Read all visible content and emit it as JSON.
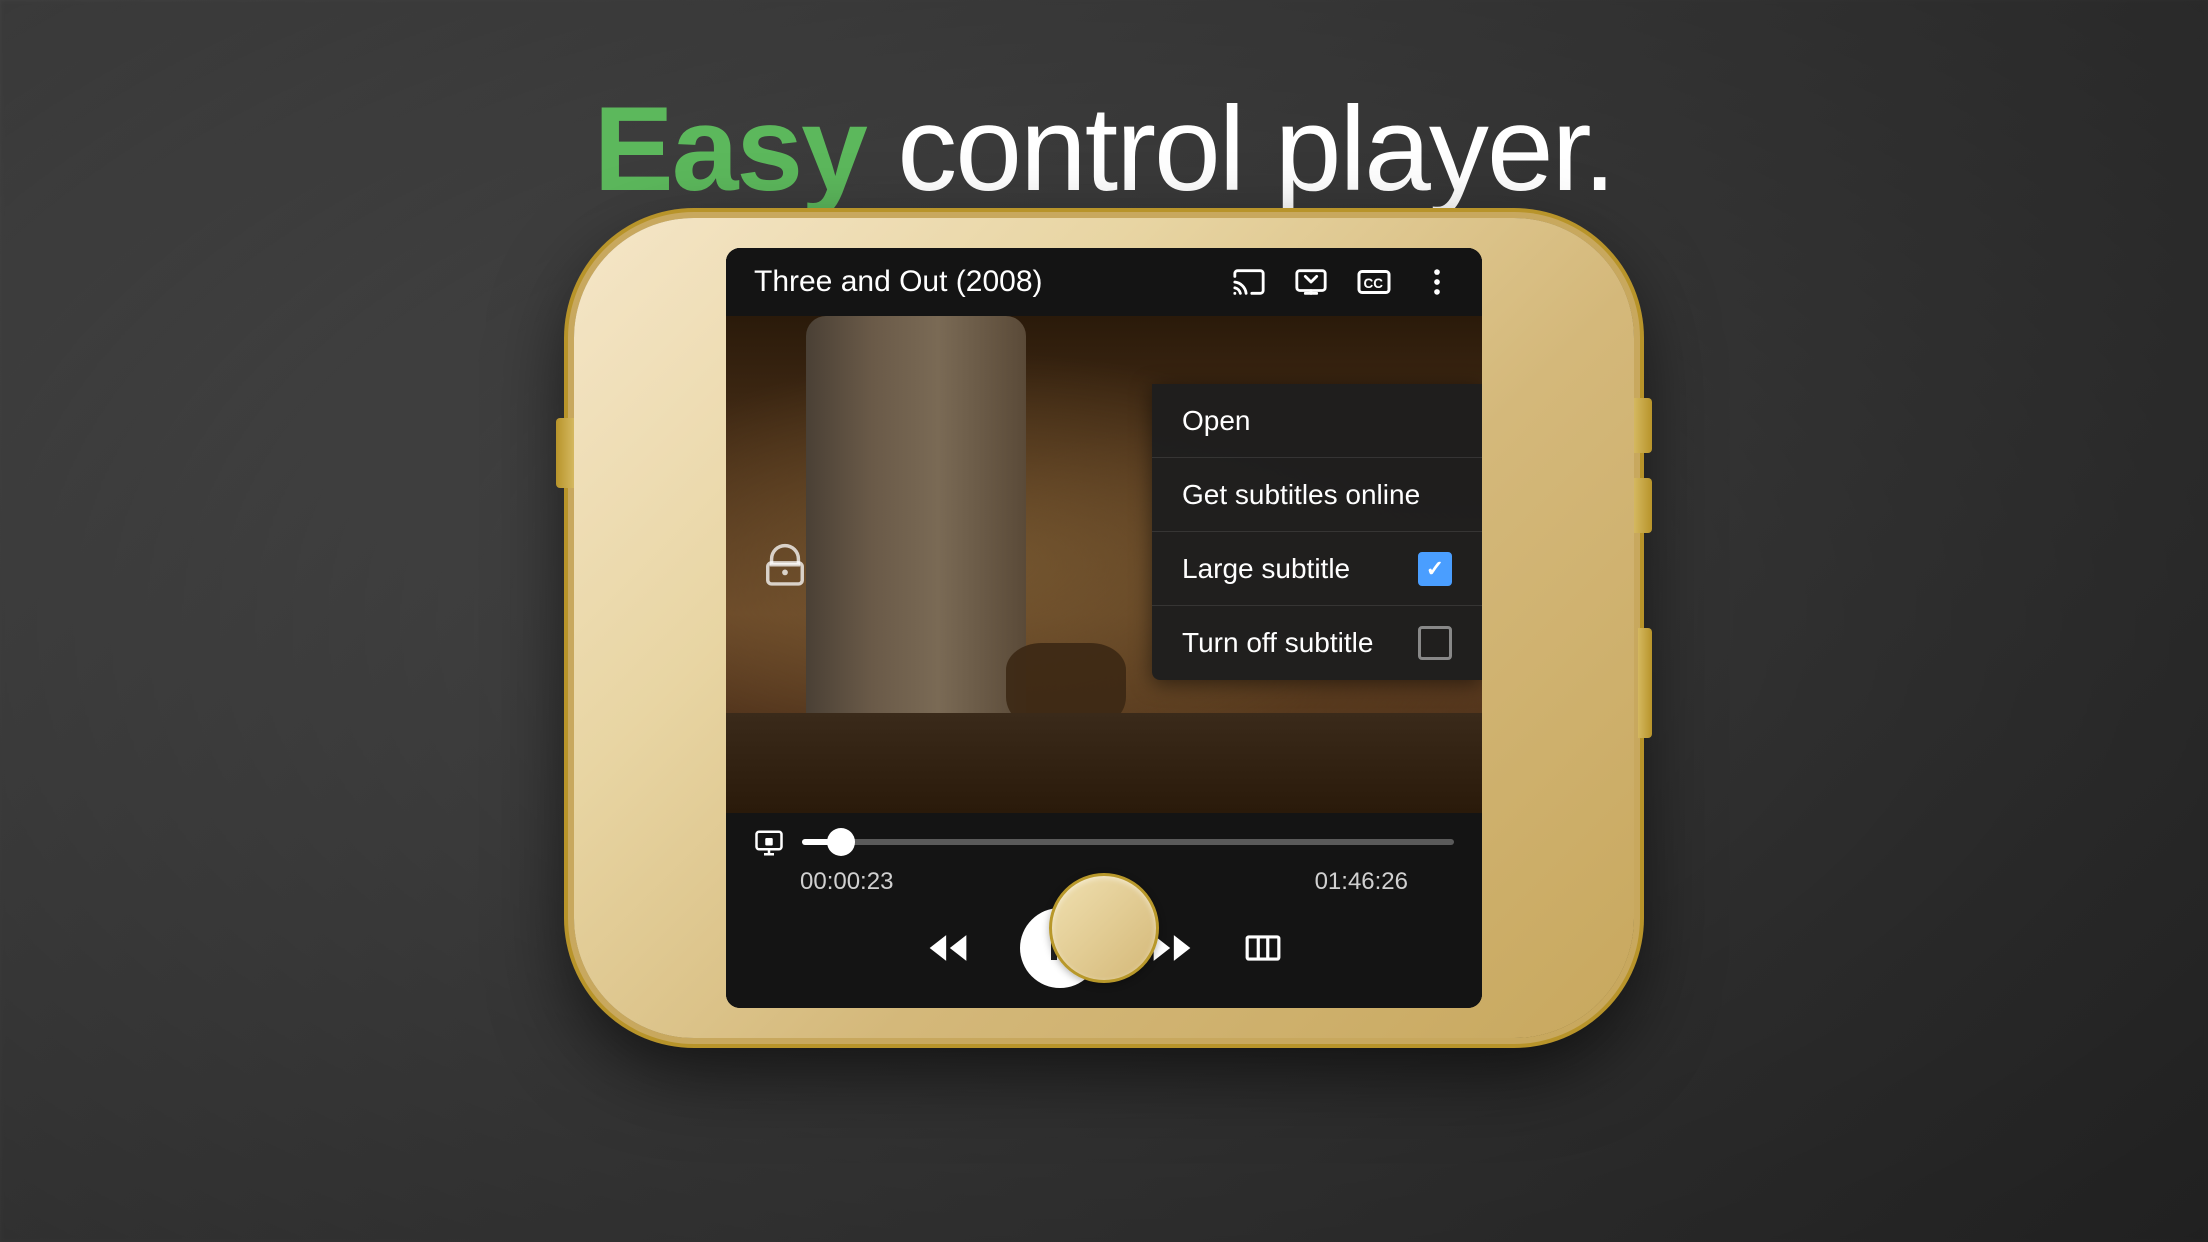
{
  "page": {
    "title_easy": "Easy",
    "title_rest": " control player.",
    "background_color": "#3a3a3a"
  },
  "player": {
    "title": "Three and Out (2008)",
    "time_current": "00:00:23",
    "time_total": "01:46:26",
    "progress_percent": 6
  },
  "toolbar_icons": {
    "cast": "cast-icon",
    "screen": "screen-mirror-icon",
    "cc": "cc-icon",
    "more": "more-icon"
  },
  "dropdown": {
    "items": [
      {
        "label": "Open",
        "checkbox": "none"
      },
      {
        "label": "Get subtitles online",
        "checkbox": "none"
      },
      {
        "label": "Large subtitle",
        "checkbox": "checked"
      },
      {
        "label": "Turn off subtitle",
        "checkbox": "unchecked"
      }
    ]
  },
  "controls": {
    "lock_icon": "lock-rotate-icon",
    "rewind_icon": "rewind-icon",
    "pause_icon": "pause-icon",
    "forward_icon": "forward-icon",
    "aspect_icon": "aspect-ratio-icon"
  },
  "colors": {
    "accent_green": "#5cb85c",
    "accent_blue": "#4a9eff",
    "text_white": "#ffffff",
    "bg_dark": "#1a1a1a"
  }
}
